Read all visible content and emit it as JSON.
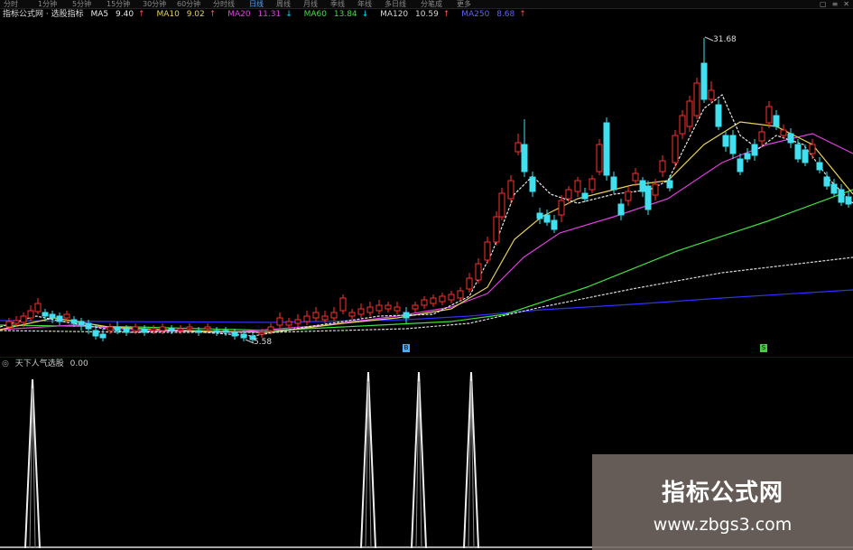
{
  "toolbar": {
    "items": [
      "分时",
      "1分钟",
      "5分钟",
      "15分钟",
      "30分钟",
      "60分钟",
      "分时线",
      "日线",
      "周线",
      "月线",
      "季线",
      "年线",
      "多日线",
      "分笔成",
      "更多"
    ],
    "active_index": 7
  },
  "window_controls": [
    "▢",
    "≡",
    "✕"
  ],
  "header": {
    "title": "指标公式网 · 选股指标",
    "ma_items": [
      {
        "label": "MA5",
        "value": "9.40",
        "dir": "↑",
        "color": "#e8e8e8"
      },
      {
        "label": "MA10",
        "value": "9.02",
        "dir": "↑",
        "color": "#e8d25a"
      },
      {
        "label": "MA20",
        "value": "11.31",
        "dir": "↓",
        "color": "#e040e0"
      },
      {
        "label": "MA60",
        "value": "13.84",
        "dir": "↓",
        "color": "#40e040"
      },
      {
        "label": "MA120",
        "value": "10.59",
        "dir": "↑",
        "color": "#d8d8d8"
      },
      {
        "label": "MA250",
        "value": "8.68",
        "dir": "↑",
        "color": "#6060ff"
      }
    ]
  },
  "price_high_label": "31.68",
  "price_low_label": "5.58",
  "date_markers": [
    {
      "text": "B",
      "color": "#4aa8ff"
    },
    {
      "text": "S",
      "color": "#40d040"
    }
  ],
  "sub_indicator": {
    "name": "天下人气选股",
    "value": "0.00"
  },
  "watermark": {
    "title": "指标公式网",
    "url": "www.zbgs3.com"
  },
  "colors": {
    "up": "#ff3030",
    "down": "#40e0f0",
    "ma5": "#e8e8e8",
    "ma10": "#e8d25a",
    "ma20": "#e040e0",
    "ma60": "#40e040",
    "ma120": "#d8d8d8",
    "ma250": "#3030ff"
  }
}
